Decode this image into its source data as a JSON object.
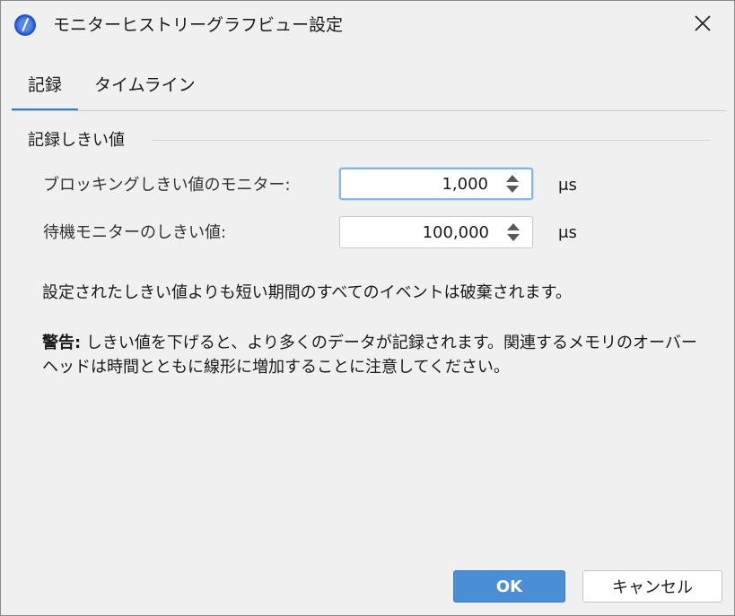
{
  "window": {
    "title": "モニターヒストリーグラフビュー設定",
    "app_icon": "gauge-icon",
    "close_icon": "close-icon"
  },
  "tabs": [
    {
      "label": "記録",
      "active": true
    },
    {
      "label": "タイムライン",
      "active": false
    }
  ],
  "group": {
    "title": "記録しきい値"
  },
  "fields": [
    {
      "label": "ブロッキングしきい値のモニター:",
      "value": "1,000",
      "unit": "μs",
      "focused": true
    },
    {
      "label": "待機モニターのしきい値:",
      "value": "100,000",
      "unit": "μs",
      "focused": false
    }
  ],
  "info": "設定されたしきい値よりも短い期間のすべてのイベントは破棄されます。",
  "warning": {
    "label": "警告:",
    "text": " しきい値を下げると、より多くのデータが記録されます。関連するメモリのオーバーヘッドは時間とともに線形に増加することに注意してください。"
  },
  "buttons": {
    "ok": "OK",
    "cancel": "キャンセル"
  },
  "colors": {
    "accent": "#4a8fd6",
    "tab_underline": "#2f7fd0",
    "background": "#f0f0f0"
  }
}
